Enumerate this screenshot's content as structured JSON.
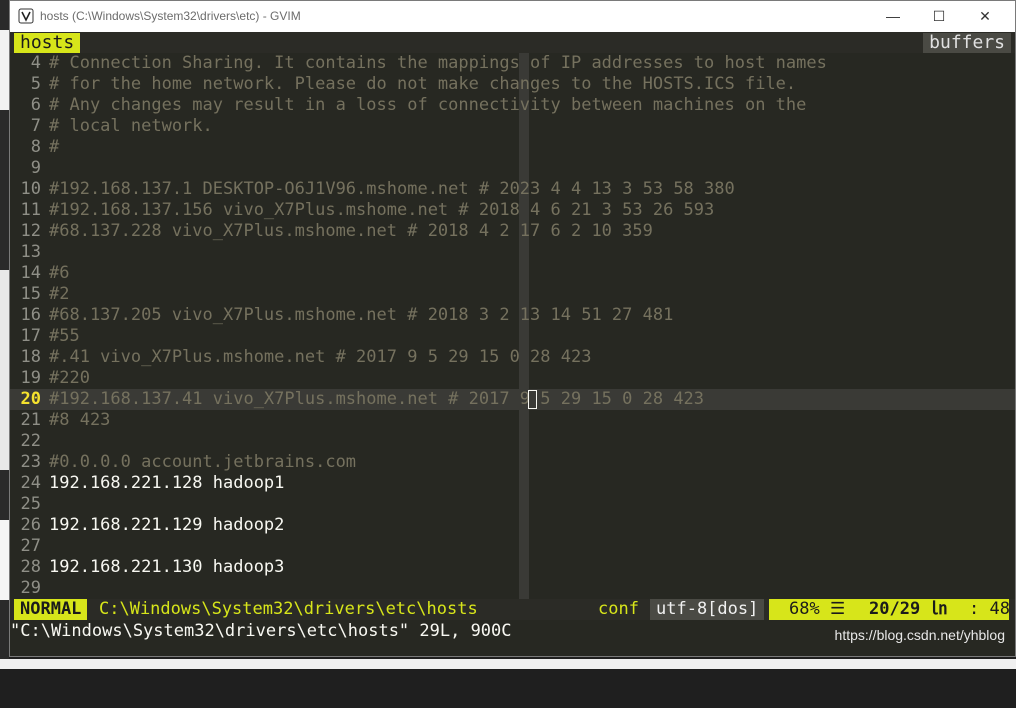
{
  "window": {
    "title": "hosts (C:\\Windows\\System32\\drivers\\etc) - GVIM",
    "controls": {
      "minimize": "—",
      "maximize": "☐",
      "close": "✕"
    }
  },
  "tabline": {
    "active_tab": "hosts",
    "right_label": "buffers"
  },
  "lines": [
    {
      "num": "4",
      "text": "# Connection Sharing. It contains the mappings of IP addresses to host names",
      "style": "comment"
    },
    {
      "num": "5",
      "text": "# for the home network. Please do not make changes to the HOSTS.ICS file.",
      "style": "comment"
    },
    {
      "num": "6",
      "text": "# Any changes may result in a loss of connectivity between machines on the",
      "style": "comment"
    },
    {
      "num": "7",
      "text": "# local network.",
      "style": "comment"
    },
    {
      "num": "8",
      "text": "#",
      "style": "comment"
    },
    {
      "num": "9",
      "text": "",
      "style": "normal"
    },
    {
      "num": "10",
      "text": "#192.168.137.1 DESKTOP-O6J1V96.mshome.net # 2023 4 4 13 3 53 58 380",
      "style": "comment"
    },
    {
      "num": "11",
      "text": "#192.168.137.156 vivo_X7Plus.mshome.net # 2018 4 6 21 3 53 26 593",
      "style": "comment"
    },
    {
      "num": "12",
      "text": "#68.137.228 vivo_X7Plus.mshome.net # 2018 4 2 17 6 2 10 359",
      "style": "comment"
    },
    {
      "num": "13",
      "text": "",
      "style": "normal"
    },
    {
      "num": "14",
      "text": "#6",
      "style": "comment"
    },
    {
      "num": "15",
      "text": "#2",
      "style": "comment"
    },
    {
      "num": "16",
      "text": "#68.137.205 vivo_X7Plus.mshome.net # 2018 3 2 13 14 51 27 481",
      "style": "comment"
    },
    {
      "num": "17",
      "text": "#55",
      "style": "comment"
    },
    {
      "num": "18",
      "text": "#.41 vivo_X7Plus.mshome.net # 2017 9 5 29 15 0 28 423",
      "style": "comment"
    },
    {
      "num": "19",
      "text": "#220",
      "style": "comment"
    },
    {
      "num": "20",
      "text": "#192.168.137.41 vivo_X7Plus.mshome.net # 2017 9 5 29 15 0 28 423",
      "style": "comment",
      "current": true
    },
    {
      "num": "21",
      "text": "#8 423",
      "style": "comment"
    },
    {
      "num": "22",
      "text": "",
      "style": "normal"
    },
    {
      "num": "23",
      "text": "#0.0.0.0 account.jetbrains.com",
      "style": "comment"
    },
    {
      "num": "24",
      "text": "192.168.221.128 hadoop1",
      "style": "normal"
    },
    {
      "num": "25",
      "text": "",
      "style": "normal"
    },
    {
      "num": "26",
      "text": "192.168.221.129 hadoop2",
      "style": "normal"
    },
    {
      "num": "27",
      "text": "",
      "style": "normal"
    },
    {
      "num": "28",
      "text": "192.168.221.130 hadoop3",
      "style": "normal"
    },
    {
      "num": "29",
      "text": "",
      "style": "normal"
    }
  ],
  "statusline": {
    "mode": "NORMAL",
    "filepath": "C:\\Windows\\System32\\drivers\\etc\\hosts",
    "filetype": "conf",
    "encoding": "utf-8[dos]",
    "percent": "68% ☰",
    "line_info": "20/29 ㏑",
    "column": ":  48"
  },
  "cmdline": {
    "message": "\"C:\\Windows\\System32\\drivers\\etc\\hosts\" 29L, 900C"
  },
  "watermark": "https://blog.csdn.net/yhblog",
  "colors": {
    "accent": "#d7e51a",
    "background": "#272822",
    "comment": "#75715e",
    "text": "#f8f8f2"
  }
}
